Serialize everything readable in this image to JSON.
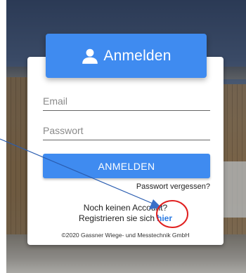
{
  "header": {
    "icon": "user-icon",
    "title": "Anmelden"
  },
  "form": {
    "email_placeholder": "Email",
    "password_placeholder": "Passwort",
    "submit_label": "ANMELDEN",
    "forgot_password": "Passwort vergessen?"
  },
  "footer": {
    "no_account_text": "Noch keinen Account?",
    "register_prefix": "Registrieren sie sich",
    "register_link": "hier",
    "copyright": "©2020 Gassner Wiege- und Messtechnik GmbH"
  },
  "colors": {
    "accent": "#3f8bf0",
    "link": "#2a7ae2",
    "annotation_arrow": "#2a5db0",
    "annotation_circle": "#e02020"
  }
}
